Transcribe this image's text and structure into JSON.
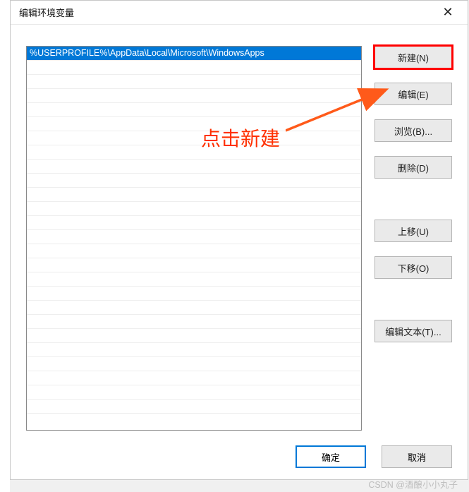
{
  "window": {
    "title": "编辑环境变量",
    "close_label": "✕"
  },
  "list": {
    "items": [
      "%USERPROFILE%\\AppData\\Local\\Microsoft\\WindowsApps"
    ],
    "selected_index": 0,
    "empty_rows": 25
  },
  "buttons": {
    "new": "新建(N)",
    "edit": "编辑(E)",
    "browse": "浏览(B)...",
    "delete": "删除(D)",
    "move_up": "上移(U)",
    "move_down": "下移(O)",
    "edit_text": "编辑文本(T)..."
  },
  "dialog_buttons": {
    "ok": "确定",
    "cancel": "取消"
  },
  "annotation": {
    "text": "点击新建",
    "arrow_color": "#ff5a1a"
  },
  "watermark": "CSDN @酒酿小小丸子"
}
